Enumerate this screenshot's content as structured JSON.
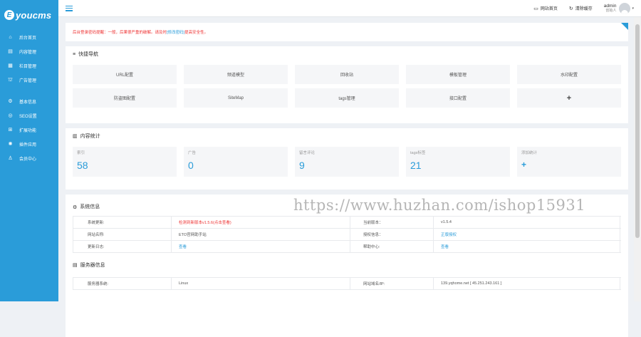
{
  "brand": {
    "mark": "E",
    "name": "youcms"
  },
  "sidebar": {
    "items": [
      {
        "label": "后台首页",
        "icon": "home-icon"
      },
      {
        "label": "内容管理",
        "icon": "content-icon"
      },
      {
        "label": "栏目管理",
        "icon": "column-icon"
      },
      {
        "label": "广告管理",
        "icon": "ad-icon"
      },
      {
        "label": "基本信息",
        "icon": "gear-icon"
      },
      {
        "label": "SEO设置",
        "icon": "seo-icon"
      },
      {
        "label": "扩展功能",
        "icon": "grid-icon"
      },
      {
        "label": "插件应用",
        "icon": "plugin-icon"
      },
      {
        "label": "会员中心",
        "icon": "user-icon"
      }
    ]
  },
  "header": {
    "site_home": "网站首页",
    "clear_cache": "清除缓存",
    "user_name": "admin",
    "user_role": "创始人"
  },
  "notice": {
    "text_before": "后台登录密码提醒：一般，后果很严重的破解。请及时",
    "link": "[修改密码]",
    "text_after": "提高安全性。"
  },
  "quick": {
    "title": "快捷导航",
    "items": [
      "URL配置",
      "频道模型",
      "回收站",
      "模板管理",
      "水印配置",
      "防盗图配置",
      "SiteMap",
      "tags管理",
      "接口配置",
      "+"
    ]
  },
  "stats": {
    "title": "内容统计",
    "cards": [
      {
        "label": "索引",
        "value": "58"
      },
      {
        "label": "广告",
        "value": "0"
      },
      {
        "label": "留言评论",
        "value": "9"
      },
      {
        "label": "tags标签",
        "value": "21"
      },
      {
        "label": "添加统计",
        "value": "+"
      }
    ]
  },
  "system": {
    "title": "系统信息",
    "rows": [
      {
        "k1": "系统更新:",
        "v1": "检测到新版本v1.5.6(点击查看)",
        "k2": "当前版本：",
        "v2": "v1.5.4"
      },
      {
        "k1": "网站名称:",
        "v1": "ETO官网助手站",
        "k2": "授权信息：",
        "v2": "正版授权"
      },
      {
        "k1": "更新日志:",
        "v1": "查看",
        "k2": "帮助中心:",
        "v2": "查看"
      }
    ]
  },
  "server": {
    "title": "服务器信息",
    "rows": [
      {
        "k1": "服务器系统:",
        "v1": "Linux",
        "k2": "网站域名/IP:",
        "v2": "139.yqhome.net [ 45.251.243.161 ]"
      }
    ]
  },
  "watermark": "https://www.huzhan.com/ishop15931",
  "colors": {
    "accent": "#2a9cd9",
    "alert": "#ee3333",
    "background": "#eef1f5"
  }
}
